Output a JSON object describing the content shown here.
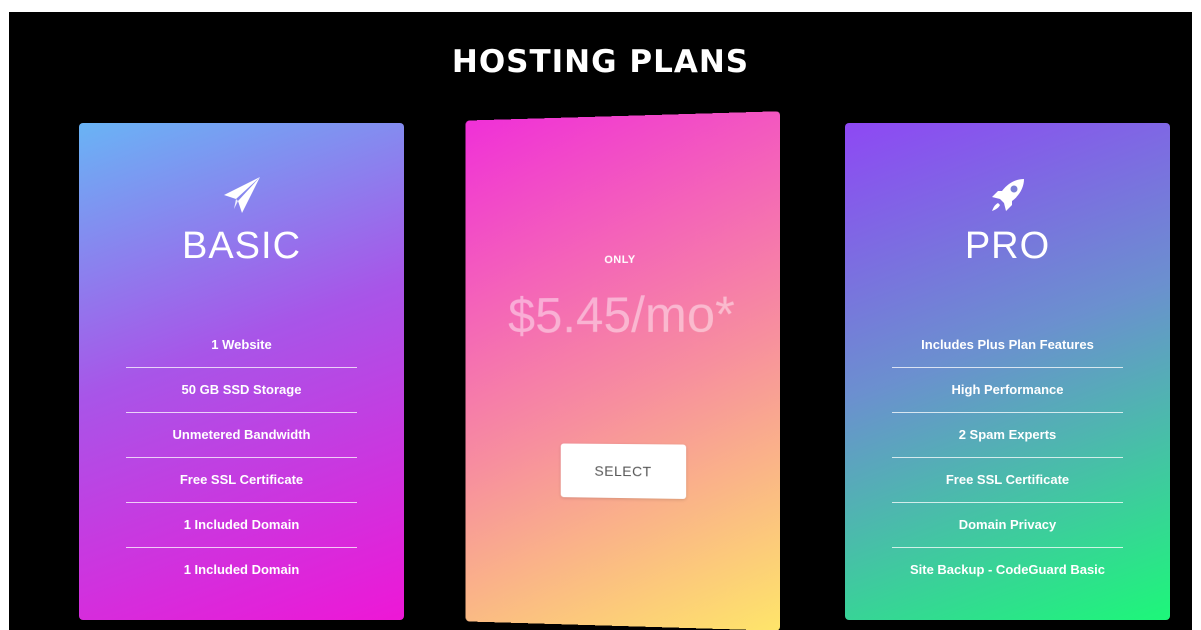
{
  "header": {
    "title": "HOSTING PLANS"
  },
  "plans": [
    {
      "name": "BASIC",
      "icon": "paper-plane-icon",
      "features": [
        "1 Website",
        "50 GB SSD Storage",
        "Unmetered Bandwidth",
        "Free SSL Certificate",
        "1 Included Domain",
        "1 Included Domain"
      ]
    },
    {
      "only_label": "ONLY",
      "price": "$5.45/mo*",
      "select_label": "SELECT"
    },
    {
      "name": "PRO",
      "icon": "rocket-icon",
      "features": [
        "Includes Plus Plan Features",
        "High Performance",
        "2 Spam Experts",
        "Free SSL Certificate",
        "Domain Privacy",
        "Site Backup - CodeGuard Basic"
      ]
    }
  ],
  "colors": {
    "background": "#000000",
    "basic_gradient": [
      "#69b4f5",
      "#a855e8",
      "#ee17d6"
    ],
    "featured_gradient": [
      "#f030d8",
      "#f78f9e",
      "#fee56a"
    ],
    "pro_gradient": [
      "#8e48f4",
      "#6b90cf",
      "#1df779"
    ]
  }
}
